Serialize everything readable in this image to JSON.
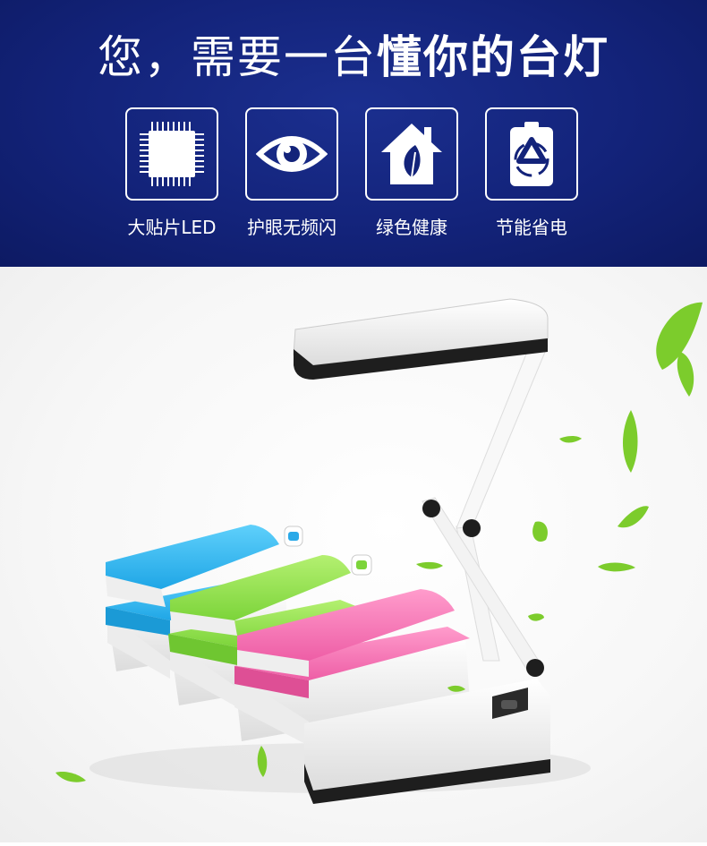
{
  "headline": {
    "part1": "您，需要一台",
    "part2": "懂你的台灯"
  },
  "features": [
    {
      "icon": "chip-icon",
      "label": "大贴片LED"
    },
    {
      "icon": "eye-icon",
      "label": "护眼无频闪"
    },
    {
      "icon": "house-leaf-icon",
      "label": "绿色健康"
    },
    {
      "icon": "battery-recycle-icon",
      "label": "节能省电"
    }
  ],
  "colors": {
    "banner": "#13237a",
    "lamp_blue": "#29b6f6",
    "lamp_green": "#8ee04a",
    "lamp_pink": "#f272b4",
    "lamp_white": "#f4f4f4",
    "leaf": "#7ccc2c"
  }
}
